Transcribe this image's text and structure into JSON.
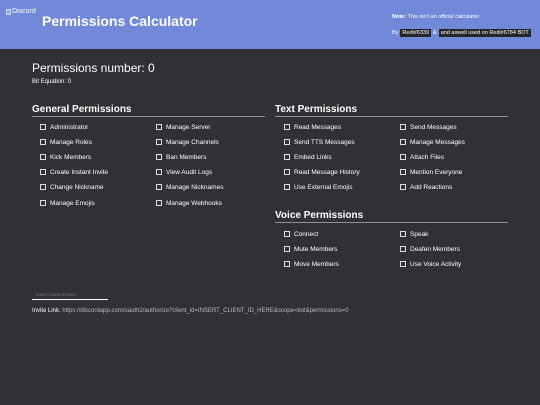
{
  "header": {
    "logo_alt": "Discord",
    "title": "Permissions Calculator",
    "note_label": "Note:",
    "note_text": " This isn't an official calculator.",
    "by_label": "By",
    "author": "Redi#6339",
    "and_text": "&",
    "helper": "and aswell used on Redi#6784 BOT"
  },
  "summary": {
    "permissions_number_label": "Permissions number: 0",
    "bit_equation_label": "Bit Equation: 0"
  },
  "general": {
    "title": "General Permissions",
    "items": [
      "Administrator",
      "Manage Server",
      "Manage Roles",
      "Manage Channels",
      "Kick Members",
      "Ban Members",
      "Create Instant Invite",
      "View Audit Logs",
      "Change Nickname",
      "Manage Nicknames",
      "Manage Emojis",
      "Manage Webhooks"
    ]
  },
  "text": {
    "title": "Text Permissions",
    "items": [
      "Read Messages",
      "Send Messages",
      "Send TTS Messages",
      "Manage Messages",
      "Embed Links",
      "Attach Files",
      "Read Message History",
      "Mention Everyone",
      "Use External Emojis",
      "Add Reactions"
    ]
  },
  "voice": {
    "title": "Voice Permissions",
    "items": [
      "Connect",
      "Speak",
      "Mute Members",
      "Deafen Members",
      "Move Members",
      "Use Voice Activity"
    ]
  },
  "client": {
    "placeholder": "Insert Client ID here",
    "value": ""
  },
  "invite": {
    "label": "Invite Link:",
    "url": "https://discordapp.com/oauth2/authorize?client_id=INSERT_CLIENT_ID_HERE&scope=bot&permissions=0"
  },
  "colors": {
    "header_bg": "#7289da",
    "page_bg": "#2f3136",
    "tag_bg": "#23272a"
  }
}
